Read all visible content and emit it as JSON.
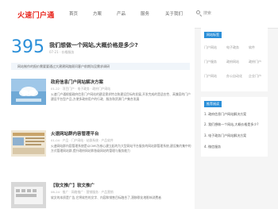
{
  "header": {
    "logo": "火速门户通",
    "nav": [
      "首页",
      "方案",
      "产品",
      "服务",
      "关于我们"
    ],
    "search_placeholder": "搜索"
  },
  "hero": {
    "number": "395",
    "title": "我们想做一个网站,大概价格是多少?",
    "meta": "07-21   · 价格服务",
    "desc": "网站制作的报价需要要通过大建建网路顾问客户前期沟没需求调研"
  },
  "articles": [
    {
      "title": "政府信息门户网站解决方案",
      "meta": "01-22   · 项目门户 · 电子政务 · 政府门户网站",
      "desc": "火速门户通根据政府信息门户网站的建设需求特点和建设目标的发展,开发完成的是适应性、高兼容的门户建设平台型产品,方便多政府用户的行政、服务和资源门户集合发展"
    },
    {
      "title": "火速网站群内容管理平台",
      "meta": "01-04   · 产品 · 门户网站 · 站群系统 · 产品软件",
      "desc": "火速网站群内容管理系统是以CMS为核心建立起的为大型网站平台服务的网站群管理系统,建设集约集中的方式管理网站群,提升政府网站和各级网站的管理与服务能力"
    },
    {
      "title": "【软文推广】软文推广",
      "meta": "06-24   · 推广 · 网络推广 · 营销服务 · 产品营销",
      "desc": "软文的本质是广告,它将软性的文字、内容和销售目标融合了,潜移默化地影响消费者"
    }
  ],
  "sidebar": {
    "tags_title": "网站标签",
    "tags": [
      "门户网站",
      "电子政务",
      "软件",
      "门户服务",
      "政府网站",
      "政府门户",
      "门户网站",
      "办公自动化",
      "企业门户"
    ],
    "recommend_title": "推荐阅读",
    "recommend": [
      "1. 政府信息门户网站解决方案",
      "2. 我们想做一个网站,大概价格是多少?",
      "3. 电子政务门户网站解决方案",
      "4. 微信服务"
    ]
  }
}
